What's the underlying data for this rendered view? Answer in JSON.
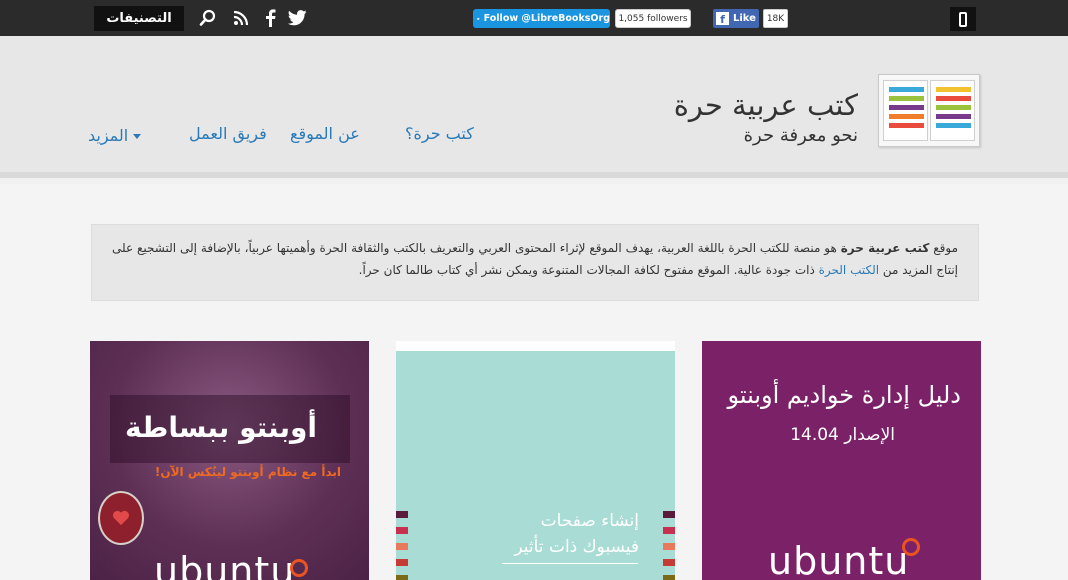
{
  "topbar": {
    "categories_label": "التصنيفات",
    "icons": [
      "search-icon",
      "rss-icon",
      "facebook-icon",
      "twitter-icon",
      "mobile-menu-icon"
    ],
    "twitter_follow_label": "Follow @LibreBooksOrg",
    "twitter_followers": "1,055 followers",
    "facebook_like_label": "Like",
    "facebook_likes": "18K"
  },
  "header": {
    "site_title": "كتب عربية حرة",
    "tagline": "نحو معرفة حرة",
    "nav": [
      "كتب حرة؟",
      "عن الموقع",
      "فريق العمل",
      "المزيد"
    ]
  },
  "intro": {
    "prefix": "موقع ",
    "site_name_bold": "كتب عربية حرة",
    "text_1": " هو منصة للكتب الحرة باللغة العربية، يهدف الموقع لإثراء المحتوى العربي والتعريف بالكتب والثقافة الحرة وأهميتها عربياً، بالإضافة إلى التشجيع على إنتاج المزيد من ",
    "link_text": "الكتب الحرة",
    "text_2": " ذات جودة عالية. الموقع مفتوح لكافة المجالات المتنوعة ويمكن نشر أي كتاب طالما كان حراً."
  },
  "books": [
    {
      "title": "دليل إدارة خواديم أوبنتو",
      "edition": "الإصدار 14.04",
      "brand": "ubuntu"
    },
    {
      "title_line1": "إنشاء صفحات",
      "title_line2": "فيسبوك ذات تأثير"
    },
    {
      "title": "أوبنتو ببساطة",
      "subtitle": "ابدأ مع نظام أوبنتو لينُكس الآن!",
      "brand": "ubuntu"
    }
  ],
  "colors": {
    "topbar_bg": "#2b2b2b",
    "header_bg": "#e7e7e7",
    "link": "#2a7ab8",
    "ubuntu_purple": "#7b2168",
    "ubuntu_orange": "#e95420",
    "twitter_blue": "#1b95e0",
    "facebook_blue": "#4267b2"
  }
}
